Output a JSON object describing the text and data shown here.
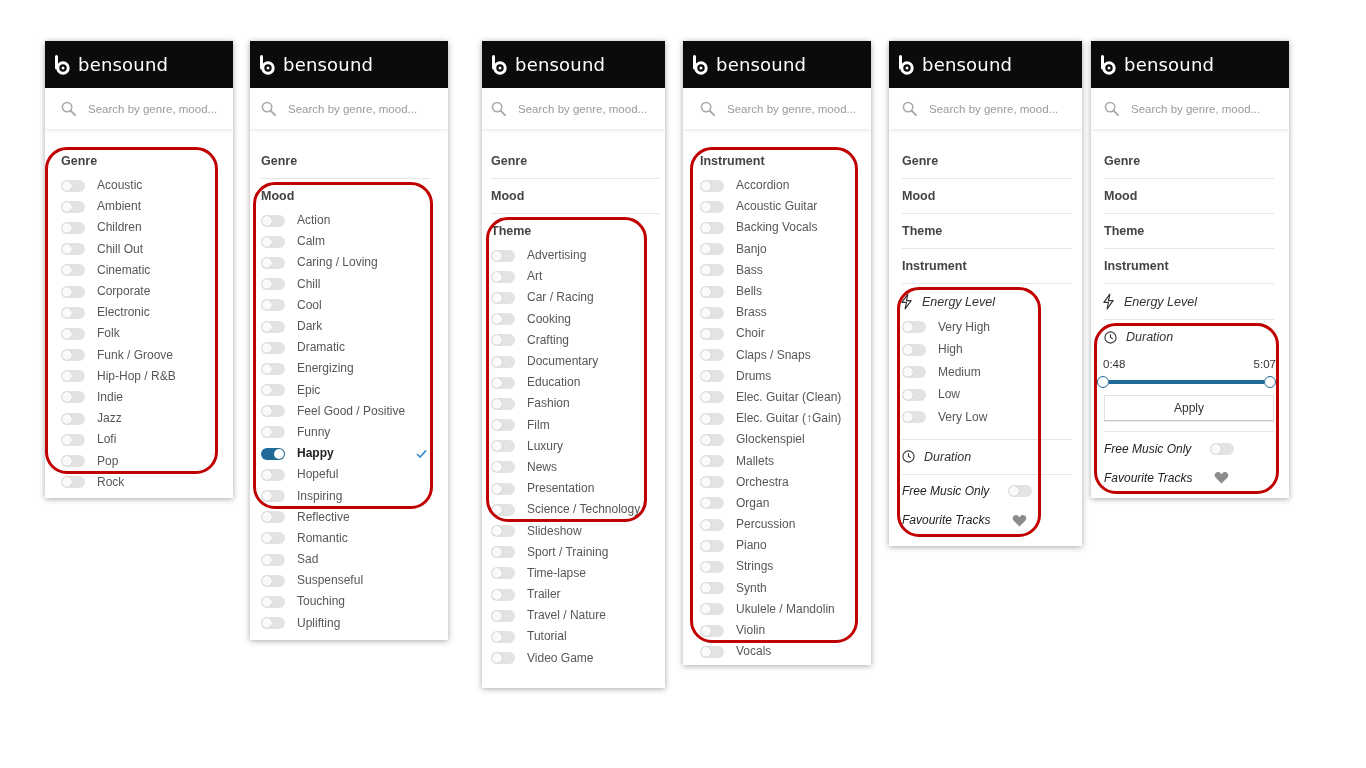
{
  "panels": [
    {
      "logo": "bensound",
      "search": {
        "placeholder": "Search by genre, mood..."
      },
      "sections": [
        {
          "kind": "category",
          "title": "Genre",
          "expanded": true,
          "circled": true,
          "items": [
            {
              "label": "Acoustic",
              "on": false,
              "circled": true
            },
            {
              "label": "Ambient",
              "on": false,
              "circled": true
            },
            {
              "label": "Children",
              "on": false,
              "circled": true
            },
            {
              "label": "Chill Out",
              "on": false,
              "circled": true
            },
            {
              "label": "Cinematic",
              "on": false,
              "circled": true
            },
            {
              "label": "Corporate",
              "on": false,
              "circled": true
            },
            {
              "label": "Electronic",
              "on": false,
              "circled": true
            },
            {
              "label": "Folk",
              "on": false,
              "circled": true
            },
            {
              "label": "Funk / Groove",
              "on": false,
              "circled": true
            },
            {
              "label": "Hip-Hop / R&B",
              "on": false,
              "circled": true
            },
            {
              "label": "Indie",
              "on": false,
              "circled": true
            },
            {
              "label": "Jazz",
              "on": false,
              "circled": true
            },
            {
              "label": "Lofi",
              "on": false,
              "circled": true
            },
            {
              "label": "Pop",
              "on": false,
              "circled": true
            },
            {
              "label": "Rock",
              "on": false,
              "circled": false
            }
          ]
        }
      ]
    },
    {
      "logo": "bensound",
      "search": {
        "placeholder": "Search by genre, mood..."
      },
      "sections": [
        {
          "kind": "category",
          "title": "Genre",
          "expanded": false,
          "circled": false
        },
        {
          "kind": "category",
          "title": "Mood",
          "expanded": true,
          "circled": true,
          "items": [
            {
              "label": "Action",
              "on": false,
              "circled": true
            },
            {
              "label": "Calm",
              "on": false,
              "circled": true
            },
            {
              "label": "Caring / Loving",
              "on": false,
              "circled": true
            },
            {
              "label": "Chill",
              "on": false,
              "circled": true
            },
            {
              "label": "Cool",
              "on": false,
              "circled": true
            },
            {
              "label": "Dark",
              "on": false,
              "circled": true
            },
            {
              "label": "Dramatic",
              "on": false,
              "circled": true
            },
            {
              "label": "Energizing",
              "on": false,
              "circled": true
            },
            {
              "label": "Epic",
              "on": false,
              "circled": true
            },
            {
              "label": "Feel Good / Positive",
              "on": false,
              "circled": true
            },
            {
              "label": "Funny",
              "on": false,
              "circled": true
            },
            {
              "label": "Happy",
              "on": true,
              "circled": true
            },
            {
              "label": "Hopeful",
              "on": false,
              "circled": true
            },
            {
              "label": "Inspiring",
              "on": false,
              "circled": true
            },
            {
              "label": "Reflective",
              "on": false,
              "circled": false
            },
            {
              "label": "Romantic",
              "on": false,
              "circled": false
            },
            {
              "label": "Sad",
              "on": false,
              "circled": false
            },
            {
              "label": "Suspenseful",
              "on": false,
              "circled": false
            },
            {
              "label": "Touching",
              "on": false,
              "circled": false
            },
            {
              "label": "Uplifting",
              "on": false,
              "circled": false
            }
          ]
        }
      ]
    },
    {
      "logo": "bensound",
      "search": {
        "placeholder": "Search by genre, mood..."
      },
      "sections": [
        {
          "kind": "category",
          "title": "Genre",
          "expanded": false,
          "circled": false
        },
        {
          "kind": "category",
          "title": "Mood",
          "expanded": false,
          "circled": false
        },
        {
          "kind": "category",
          "title": "Theme",
          "expanded": true,
          "circled": true,
          "items": [
            {
              "label": "Advertising",
              "on": false,
              "circled": true
            },
            {
              "label": "Art",
              "on": false,
              "circled": true
            },
            {
              "label": "Car / Racing",
              "on": false,
              "circled": true
            },
            {
              "label": "Cooking",
              "on": false,
              "circled": true
            },
            {
              "label": "Crafting",
              "on": false,
              "circled": true
            },
            {
              "label": "Documentary",
              "on": false,
              "circled": true
            },
            {
              "label": "Education",
              "on": false,
              "circled": true
            },
            {
              "label": "Fashion",
              "on": false,
              "circled": true
            },
            {
              "label": "Film",
              "on": false,
              "circled": true
            },
            {
              "label": "Luxury",
              "on": false,
              "circled": true
            },
            {
              "label": "News",
              "on": false,
              "circled": true
            },
            {
              "label": "Presentation",
              "on": false,
              "circled": true
            },
            {
              "label": "Science / Technology",
              "on": false,
              "circled": true
            },
            {
              "label": "Slideshow",
              "on": false,
              "circled": false
            },
            {
              "label": "Sport / Training",
              "on": false,
              "circled": false
            },
            {
              "label": "Time-lapse",
              "on": false,
              "circled": false
            },
            {
              "label": "Trailer",
              "on": false,
              "circled": false
            },
            {
              "label": "Travel / Nature",
              "on": false,
              "circled": false
            },
            {
              "label": "Tutorial",
              "on": false,
              "circled": false
            },
            {
              "label": "Video Game",
              "on": false,
              "circled": false
            }
          ]
        }
      ]
    },
    {
      "logo": "bensound",
      "search": {
        "placeholder": "Search by genre, mood..."
      },
      "sections": [
        {
          "kind": "category",
          "title": "Instrument",
          "expanded": true,
          "circled": true,
          "items": [
            {
              "label": "Accordion",
              "on": false,
              "circled": true
            },
            {
              "label": "Acoustic Guitar",
              "on": false,
              "circled": true
            },
            {
              "label": "Backing Vocals",
              "on": false,
              "circled": true
            },
            {
              "label": "Banjo",
              "on": false,
              "circled": true
            },
            {
              "label": "Bass",
              "on": false,
              "circled": true
            },
            {
              "label": "Bells",
              "on": false,
              "circled": true
            },
            {
              "label": "Brass",
              "on": false,
              "circled": true
            },
            {
              "label": "Choir",
              "on": false,
              "circled": true
            },
            {
              "label": "Claps / Snaps",
              "on": false,
              "circled": true
            },
            {
              "label": "Drums",
              "on": false,
              "circled": true
            },
            {
              "label": "Elec. Guitar (Clean)",
              "on": false,
              "circled": true
            },
            {
              "label": "Elec. Guitar (↑Gain)",
              "on": false,
              "circled": true
            },
            {
              "label": "Glockenspiel",
              "on": false,
              "circled": true
            },
            {
              "label": "Mallets",
              "on": false,
              "circled": true
            },
            {
              "label": "Orchestra",
              "on": false,
              "circled": true
            },
            {
              "label": "Organ",
              "on": false,
              "circled": true
            },
            {
              "label": "Percussion",
              "on": false,
              "circled": true
            },
            {
              "label": "Piano",
              "on": false,
              "circled": true
            },
            {
              "label": "Strings",
              "on": false,
              "circled": true
            },
            {
              "label": "Synth",
              "on": false,
              "circled": true
            },
            {
              "label": "Ukulele / Mandolin",
              "on": false,
              "circled": true
            },
            {
              "label": "Violin",
              "on": false,
              "circled": true
            },
            {
              "label": "Vocals",
              "on": false,
              "circled": false
            }
          ]
        }
      ]
    },
    {
      "logo": "bensound",
      "search": {
        "placeholder": "Search by genre, mood..."
      },
      "sections": [
        {
          "kind": "category",
          "title": "Genre",
          "expanded": false,
          "circled": false
        },
        {
          "kind": "category",
          "title": "Mood",
          "expanded": false,
          "circled": false
        },
        {
          "kind": "category",
          "title": "Theme",
          "expanded": false,
          "circled": false
        },
        {
          "kind": "category",
          "title": "Instrument",
          "expanded": false,
          "circled": false
        },
        {
          "kind": "energy",
          "title": "Energy Level",
          "expanded": true,
          "circled": true,
          "items": [
            {
              "label": "Very High",
              "on": false,
              "circled": true
            },
            {
              "label": "High",
              "on": false,
              "circled": true
            },
            {
              "label": "Medium",
              "on": false,
              "circled": true
            },
            {
              "label": "Low",
              "on": false,
              "circled": true
            },
            {
              "label": "Very Low",
              "on": false,
              "circled": true
            }
          ]
        },
        {
          "kind": "duration",
          "title": "Duration",
          "expanded": false,
          "circled": true
        }
      ],
      "options": [
        {
          "kind": "switch",
          "label": "Free Music Only",
          "on": false,
          "circled": true
        },
        {
          "kind": "favourite",
          "label": "Favourite Tracks",
          "on": false,
          "circled": true
        }
      ]
    },
    {
      "logo": "bensound",
      "search": {
        "placeholder": "Search by genre, mood..."
      },
      "sections": [
        {
          "kind": "category",
          "title": "Genre",
          "expanded": false,
          "circled": false
        },
        {
          "kind": "category",
          "title": "Mood",
          "expanded": false,
          "circled": false
        },
        {
          "kind": "category",
          "title": "Theme",
          "expanded": false,
          "circled": false
        },
        {
          "kind": "category",
          "title": "Instrument",
          "expanded": false,
          "circled": false
        },
        {
          "kind": "energy",
          "title": "Energy Level",
          "expanded": false,
          "circled": false
        },
        {
          "kind": "duration",
          "title": "Duration",
          "expanded": true,
          "circled": true,
          "range": {
            "start": "0:48",
            "end": "5:07",
            "level": 1
          },
          "button": "Apply"
        }
      ],
      "options": [
        {
          "kind": "switch",
          "label": "Free Music Only",
          "on": false,
          "circled": true
        },
        {
          "kind": "favourite",
          "label": "Favourite Tracks",
          "on": false,
          "circled": true
        }
      ]
    }
  ]
}
